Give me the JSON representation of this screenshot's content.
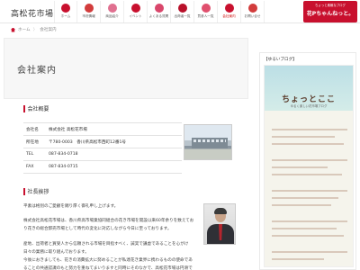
{
  "header": {
    "logo_text": "高松花市場",
    "nav": [
      {
        "label": "ホーム",
        "color": "#c8102e"
      },
      {
        "label": "市況情報",
        "color": "#d23c3c"
      },
      {
        "label": "商品紹介",
        "color": "#e07090"
      },
      {
        "label": "イベント",
        "color": "#c8102e"
      },
      {
        "label": "よくある質問",
        "color": "#d9466b"
      },
      {
        "label": "出荷者一覧",
        "color": "#b8102a"
      },
      {
        "label": "買参人一覧",
        "color": "#e0506e"
      },
      {
        "label": "会社案内",
        "color": "#c8102e"
      },
      {
        "label": "お問い合せ",
        "color": "#d23c3c"
      }
    ],
    "banner": {
      "sub": "ちょっと素敵なブログ",
      "main": "花Pちゃんねっと。"
    }
  },
  "breadcrumb": {
    "home": "ホーム",
    "sep": "〉",
    "current": "会社案内"
  },
  "page_title": "会社案内",
  "overview": {
    "heading": "会社概要",
    "rows": [
      {
        "key": "会社名",
        "value": "株式会社 高松花市場"
      },
      {
        "key": "所在地",
        "value": "〒780-0003　香川県高松市西町12番1号"
      },
      {
        "key": "TEL",
        "value": "087-834-0718"
      },
      {
        "key": "FAX",
        "value": "087-834-0715"
      }
    ]
  },
  "greeting": {
    "heading": "社長挨拶",
    "paragraphs": [
      "平素は格別のご愛顧を賜り厚く御礼申し上げます。",
      "株式会社高松花市場は、香川県高市場業協同組合の花き市場を開設以来60年余りを数えており花きの総合卸売市場として時代の変化に対応しながら今日に至っております。",
      "産地、出荷者と買受人から信頼される市場を目指すべく、誠実で謙虚であることを心がけ日々の業務に取り組んでおります。",
      "今後におきましても、花きの消費拡大に努めることが私達花き業界に携わるものの使命であることの共通認識のもと努力を重ねてまいりますと同時にそのなかで、高松花市場は円滑で公正な取引を行い地域"
    ]
  },
  "sidebar": {
    "title": "【ゆるいブログ】",
    "brand": "ちょっとここ",
    "brand_sub": "ゆるく楽しい花市場ブログ"
  }
}
